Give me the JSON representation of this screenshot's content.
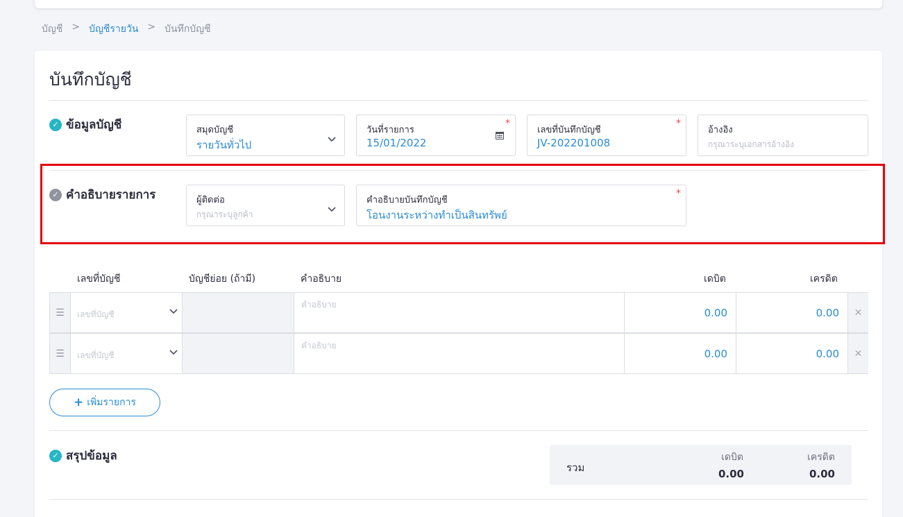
{
  "breadcrumb": {
    "items": [
      "บัญชี",
      "บัญชีรายวัน",
      "บันทึกบัญชี"
    ],
    "separator": ">"
  },
  "page_title": "บันทึกบัญชี",
  "section_account_info": {
    "title": "ข้อมูลบัญชี",
    "journal_book": {
      "label": "สมุดบัญชี",
      "value": "รายวันทั่วไป"
    },
    "transaction_date": {
      "label": "วันที่รายการ",
      "value": "15/01/2022",
      "required": "*"
    },
    "journal_number": {
      "label": "เลขที่บันทึกบัญชี",
      "value": "JV-202201008",
      "required": "*"
    },
    "reference": {
      "label": "อ้างอิง",
      "placeholder": "กรุณาระบุเอกสารอ้างอิง"
    }
  },
  "section_description": {
    "title": "คำอธิบายรายการ",
    "contact": {
      "label": "ผู้ติดต่อ",
      "placeholder": "กรุณาระบุลูกค้า"
    },
    "journal_description": {
      "label": "คำอธิบายบันทึกบัญชี",
      "value": "โอนงานระหว่างทำเป็นสินทรัพย์",
      "required": "*"
    }
  },
  "table": {
    "headers": {
      "account": "เลขที่บัญชี",
      "sub_account": "บัญชีย่อย (ถ้ามี)",
      "description": "คำอธิบาย",
      "debit": "เดบิต",
      "credit": "เครดิต"
    },
    "rows": [
      {
        "account_placeholder": "เลขที่บัญชี",
        "description_placeholder": "คำอธิบาย",
        "debit": "0.00",
        "credit": "0.00"
      },
      {
        "account_placeholder": "เลขที่บัญชี",
        "description_placeholder": "คำอธิบาย",
        "debit": "0.00",
        "credit": "0.00"
      }
    ],
    "add_button": "เพิ่มรายการ"
  },
  "section_summary": {
    "title": "สรุปข้อมูล",
    "total_label": "รวม",
    "debit_label": "เดบิต",
    "credit_label": "เครดิต",
    "debit_total": "0.00",
    "credit_total": "0.00"
  },
  "colors": {
    "accent": "#2a8bd3",
    "check_teal": "#26b6c6",
    "required": "#e84848",
    "highlight": "#e4000d"
  },
  "icons": {
    "check": "check-circle-icon",
    "calendar": "calendar-icon",
    "chevron": "chevron-down-icon",
    "drag": "drag-handle-icon",
    "delete": "close-icon",
    "add": "plus-icon"
  }
}
